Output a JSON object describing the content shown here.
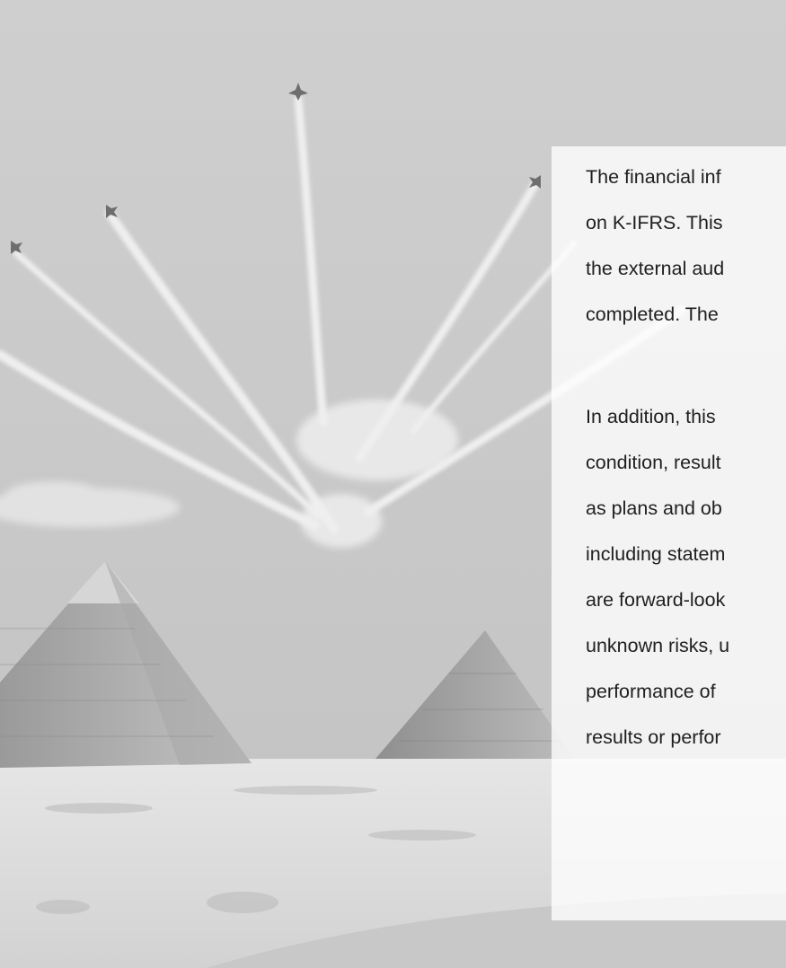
{
  "disclaimer": {
    "paragraph1": [
      "The financial inf",
      "on K-IFRS. This",
      "the external aud",
      "completed. The"
    ],
    "paragraph2": [
      "In addition, this",
      "condition, result",
      "as plans and ob",
      "including statem",
      "are forward-look",
      "unknown risks, u",
      "performance of",
      "results or perfor"
    ]
  },
  "colors": {
    "text": "#1f1f1f",
    "panel": "#ffffff",
    "sky": "#c9c9c9"
  }
}
